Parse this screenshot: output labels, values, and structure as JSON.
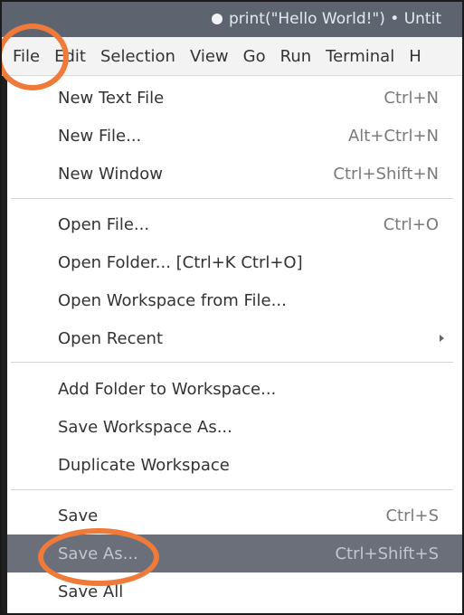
{
  "window": {
    "title": "print(\"Hello World!\") • Untit"
  },
  "menubar": {
    "items": [
      "File",
      "Edit",
      "Selection",
      "View",
      "Go",
      "Run",
      "Terminal",
      "H"
    ]
  },
  "file_menu": {
    "items": [
      {
        "label": "New Text File",
        "shortcut": "Ctrl+N"
      },
      {
        "label": "New File...",
        "shortcut": "Alt+Ctrl+N"
      },
      {
        "label": "New Window",
        "shortcut": "Ctrl+Shift+N"
      },
      {
        "label": "Open File...",
        "shortcut": "Ctrl+O"
      },
      {
        "label": "Open Folder... [Ctrl+K Ctrl+O]",
        "shortcut": ""
      },
      {
        "label": "Open Workspace from File...",
        "shortcut": ""
      },
      {
        "label": "Open Recent",
        "shortcut": ""
      },
      {
        "label": "Add Folder to Workspace...",
        "shortcut": ""
      },
      {
        "label": "Save Workspace As...",
        "shortcut": ""
      },
      {
        "label": "Duplicate Workspace",
        "shortcut": ""
      },
      {
        "label": "Save",
        "shortcut": "Ctrl+S"
      },
      {
        "label": "Save As...",
        "shortcut": "Ctrl+Shift+S"
      },
      {
        "label": "Save All",
        "shortcut": ""
      }
    ],
    "highlighted_item": "Save As..."
  },
  "colors": {
    "titlebar": "#5d6470",
    "highlight": "#6a6f7a",
    "annotation": "#f07a3a"
  }
}
